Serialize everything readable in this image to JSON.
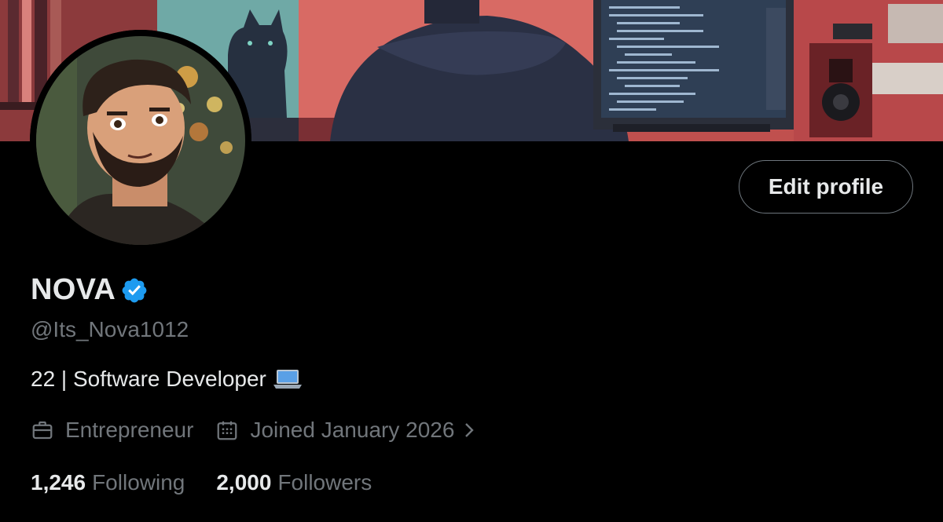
{
  "profile": {
    "display_name": "NOVA",
    "handle": "@Its_Nova1012",
    "bio": "22 | Software Developer",
    "bio_emoji": "laptop-emoji",
    "profession": "Entrepreneur",
    "joined": "Joined January 2026",
    "following_count": "1,246",
    "following_label": "Following",
    "followers_count": "2,000",
    "followers_label": "Followers"
  },
  "actions": {
    "edit_profile_label": "Edit profile"
  },
  "icons": {
    "verified": "verified-badge-icon",
    "profession": "briefcase-icon",
    "joined": "calendar-icon",
    "chevron": "chevron-right-icon"
  },
  "colors": {
    "background": "#000000",
    "text_primary": "#e7e9ea",
    "text_secondary": "#71767b",
    "verified_blue": "#1d9bf0",
    "button_border": "#6e767d"
  }
}
